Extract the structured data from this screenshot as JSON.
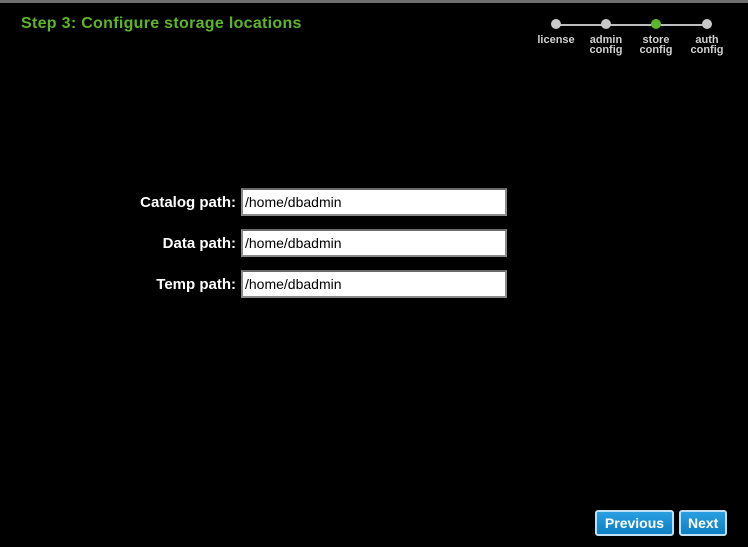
{
  "header": {
    "step_title": "Step 3: Configure storage locations"
  },
  "stepper": {
    "steps": [
      {
        "label": "license",
        "active": false
      },
      {
        "label": "admin\nconfig",
        "active": false
      },
      {
        "label": "store\nconfig",
        "active": true
      },
      {
        "label": "auth\nconfig",
        "active": false
      }
    ]
  },
  "form": {
    "catalog_label": "Catalog path:",
    "catalog_value": "/home/dbadmin",
    "data_label": "Data path:",
    "data_value": "/home/dbadmin",
    "temp_label": "Temp path:",
    "temp_value": "/home/dbadmin"
  },
  "nav": {
    "previous_label": "Previous",
    "next_label": "Next"
  },
  "colors": {
    "background": "#000000",
    "title_green": "#5db52a",
    "active_step": "#5db52a",
    "inactive_step": "#c8c8c8",
    "button_blue": "#1a8fd4"
  }
}
